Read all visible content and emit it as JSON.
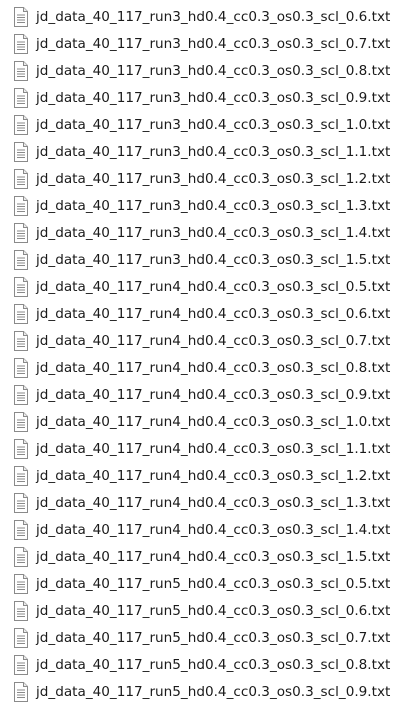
{
  "file_icon": "text-document-icon",
  "files": [
    "jd_data_40_117_run3_hd0.4_cc0.3_os0.3_scl_0.6.txt",
    "jd_data_40_117_run3_hd0.4_cc0.3_os0.3_scl_0.7.txt",
    "jd_data_40_117_run3_hd0.4_cc0.3_os0.3_scl_0.8.txt",
    "jd_data_40_117_run3_hd0.4_cc0.3_os0.3_scl_0.9.txt",
    "jd_data_40_117_run3_hd0.4_cc0.3_os0.3_scl_1.0.txt",
    "jd_data_40_117_run3_hd0.4_cc0.3_os0.3_scl_1.1.txt",
    "jd_data_40_117_run3_hd0.4_cc0.3_os0.3_scl_1.2.txt",
    "jd_data_40_117_run3_hd0.4_cc0.3_os0.3_scl_1.3.txt",
    "jd_data_40_117_run3_hd0.4_cc0.3_os0.3_scl_1.4.txt",
    "jd_data_40_117_run3_hd0.4_cc0.3_os0.3_scl_1.5.txt",
    "jd_data_40_117_run4_hd0.4_cc0.3_os0.3_scl_0.5.txt",
    "jd_data_40_117_run4_hd0.4_cc0.3_os0.3_scl_0.6.txt",
    "jd_data_40_117_run4_hd0.4_cc0.3_os0.3_scl_0.7.txt",
    "jd_data_40_117_run4_hd0.4_cc0.3_os0.3_scl_0.8.txt",
    "jd_data_40_117_run4_hd0.4_cc0.3_os0.3_scl_0.9.txt",
    "jd_data_40_117_run4_hd0.4_cc0.3_os0.3_scl_1.0.txt",
    "jd_data_40_117_run4_hd0.4_cc0.3_os0.3_scl_1.1.txt",
    "jd_data_40_117_run4_hd0.4_cc0.3_os0.3_scl_1.2.txt",
    "jd_data_40_117_run4_hd0.4_cc0.3_os0.3_scl_1.3.txt",
    "jd_data_40_117_run4_hd0.4_cc0.3_os0.3_scl_1.4.txt",
    "jd_data_40_117_run4_hd0.4_cc0.3_os0.3_scl_1.5.txt",
    "jd_data_40_117_run5_hd0.4_cc0.3_os0.3_scl_0.5.txt",
    "jd_data_40_117_run5_hd0.4_cc0.3_os0.3_scl_0.6.txt",
    "jd_data_40_117_run5_hd0.4_cc0.3_os0.3_scl_0.7.txt",
    "jd_data_40_117_run5_hd0.4_cc0.3_os0.3_scl_0.8.txt",
    "jd_data_40_117_run5_hd0.4_cc0.3_os0.3_scl_0.9.txt"
  ]
}
